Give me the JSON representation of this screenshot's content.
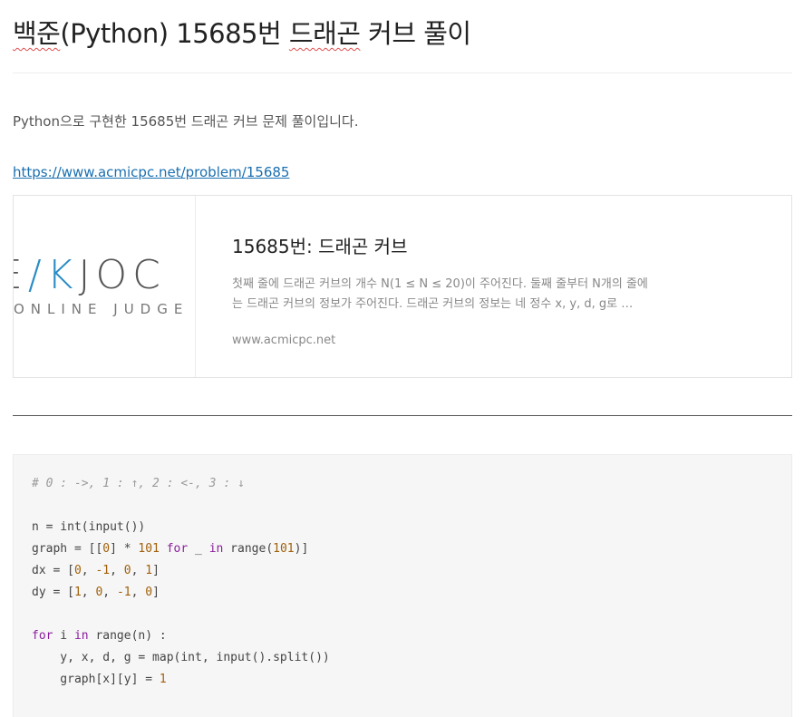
{
  "post": {
    "title_part1": "백준",
    "title_part2": "(Python) 15685번 ",
    "title_part3": "드래곤",
    "title_part4": " 커브 풀이",
    "intro": "Python으로 구현한 15685번 드래곤 커브 문제 풀이입니다.",
    "link": "https://www.acmicpc.net/problem/15685"
  },
  "card": {
    "logo_left": "E",
    "logo_accent": "/K",
    "logo_right": "JOC",
    "logo_sub": "ONLINE JUDGE",
    "title": "15685번: 드래곤 커브",
    "description": "첫째 줄에 드래곤 커브의 개수 N(1 ≤ N ≤ 20)이 주어진다. 둘째 줄부터 N개의 줄에는 드래곤 커브의 정보가 주어진다. 드래곤 커브의 정보는 네 정수 x, y, d, g로 …",
    "host": "www.acmicpc.net"
  },
  "code": {
    "language": "python",
    "lines": [
      "# 0 : ->, 1 : ↑, 2 : <-, 3 : ↓",
      "",
      "n = int(input())",
      "graph = [[0] * 101 for _ in range(101)]",
      "dx = [0, -1, 0, 1]",
      "dy = [1, 0, -1, 0]",
      "",
      "for i in range(n) :",
      "    y, x, d, g = map(int, input().split())",
      "    graph[x][y] = 1"
    ]
  }
}
